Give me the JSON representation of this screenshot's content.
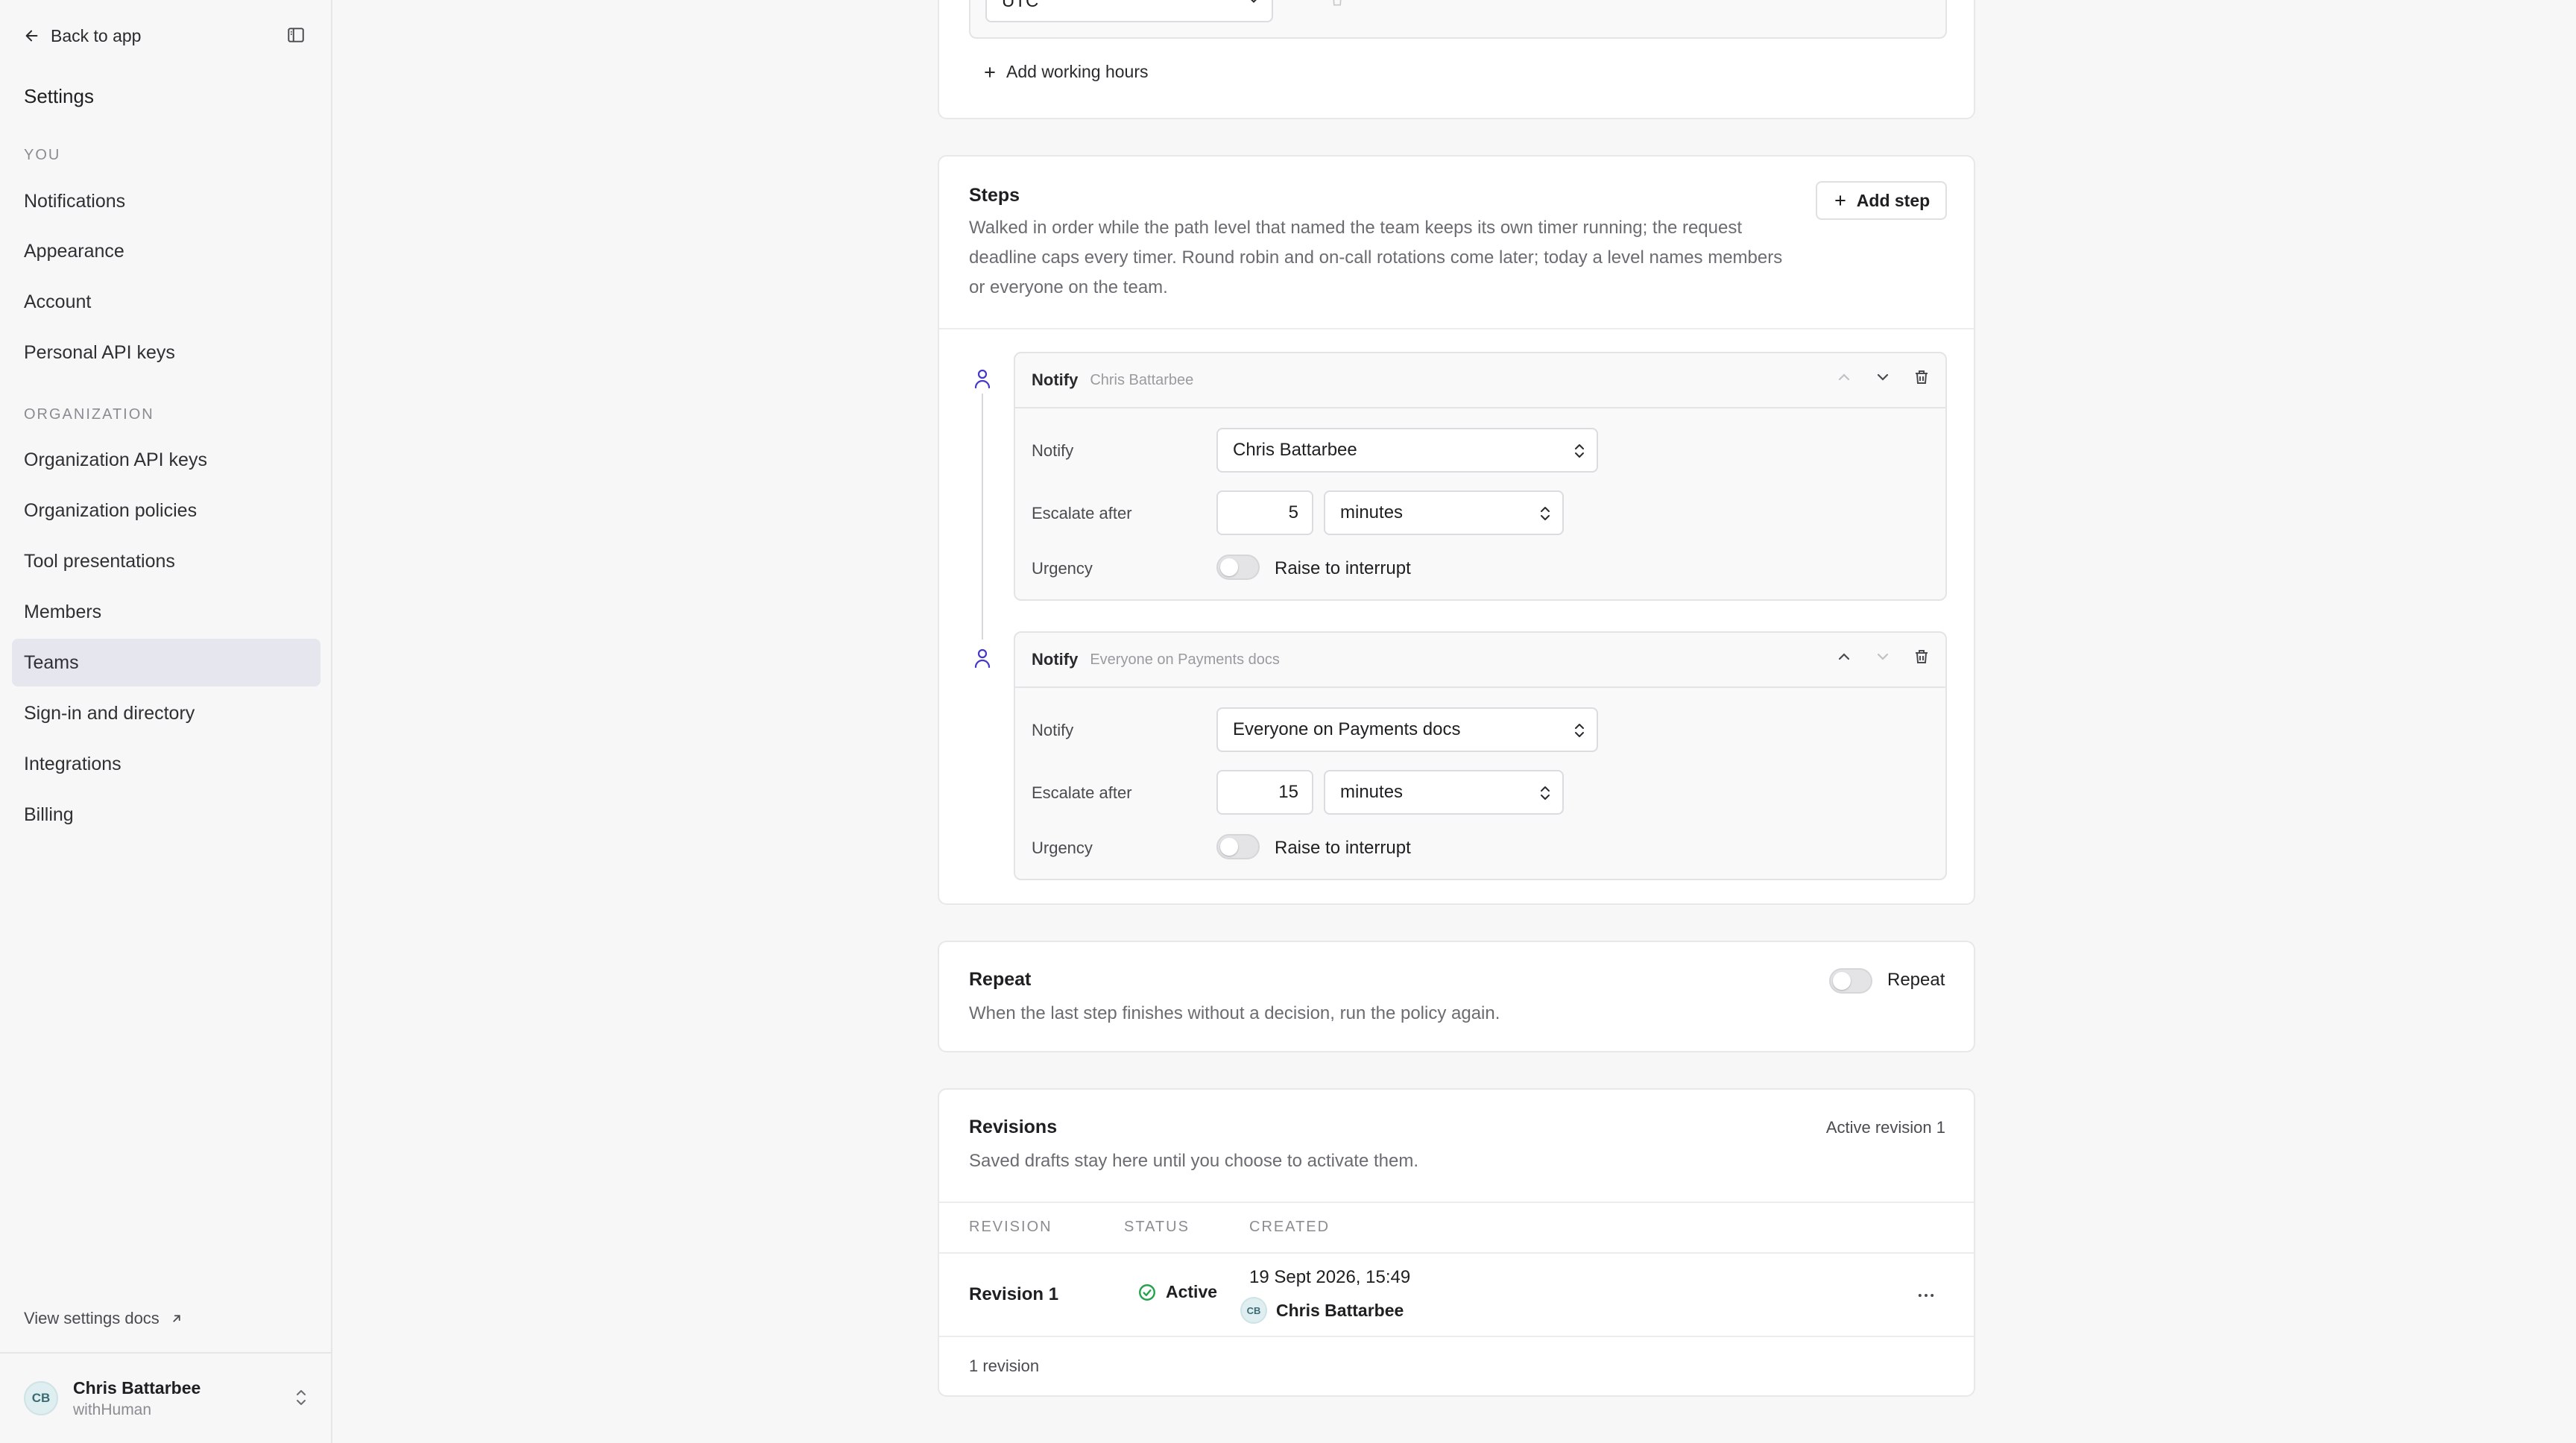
{
  "sidebar": {
    "back_label": "Back to app",
    "title": "Settings",
    "section_you": "YOU",
    "you_items": [
      {
        "label": "Notifications"
      },
      {
        "label": "Appearance"
      },
      {
        "label": "Account"
      },
      {
        "label": "Personal API keys"
      }
    ],
    "section_org": "ORGANIZATION",
    "org_items": [
      {
        "label": "Organization API keys"
      },
      {
        "label": "Organization policies"
      },
      {
        "label": "Tool presentations"
      },
      {
        "label": "Members"
      },
      {
        "label": "Teams",
        "active": true
      },
      {
        "label": "Sign-in and directory"
      },
      {
        "label": "Integrations"
      },
      {
        "label": "Billing"
      }
    ],
    "docs_label": "View settings docs",
    "user": {
      "initials": "CB",
      "name": "Chris Battarbee",
      "org": "withHuman"
    }
  },
  "working_hours": {
    "timezone_value": "UTC",
    "add_label": "Add working hours"
  },
  "steps": {
    "title": "Steps",
    "description": "Walked in order while the path level that named the team keeps its own timer running; the request deadline caps every timer. Round robin and on-call rotations come later; today a level names members or everyone on the team.",
    "add_label": "Add step",
    "items": [
      {
        "header_title": "Notify",
        "header_sub": "Chris Battarbee",
        "notify_label": "Notify",
        "notify_value": "Chris Battarbee",
        "escalate_label": "Escalate after",
        "escalate_value": "5",
        "escalate_unit": "minutes",
        "urgency_label": "Urgency",
        "urgency_toggle_label": "Raise to interrupt",
        "urgency_on": false
      },
      {
        "header_title": "Notify",
        "header_sub": "Everyone on Payments docs",
        "notify_label": "Notify",
        "notify_value": "Everyone on Payments docs",
        "escalate_label": "Escalate after",
        "escalate_value": "15",
        "escalate_unit": "minutes",
        "urgency_label": "Urgency",
        "urgency_toggle_label": "Raise to interrupt",
        "urgency_on": false
      }
    ]
  },
  "repeat": {
    "title": "Repeat",
    "description": "When the last step finishes without a decision, run the policy again.",
    "toggle_label": "Repeat",
    "on": false
  },
  "revisions": {
    "title": "Revisions",
    "active_label": "Active revision 1",
    "description": "Saved drafts stay here until you choose to activate them.",
    "columns": [
      "REVISION",
      "STATUS",
      "CREATED"
    ],
    "rows": [
      {
        "revision": "Revision 1",
        "status": "Active",
        "created_date": "19 Sept 2026, 15:49",
        "author_initials": "CB",
        "author": "Chris Battarbee"
      }
    ],
    "footer": "1 revision"
  },
  "colors": {
    "accent": "#4338ca",
    "success": "#22a24a",
    "active_nav": "#e6e6ef"
  }
}
